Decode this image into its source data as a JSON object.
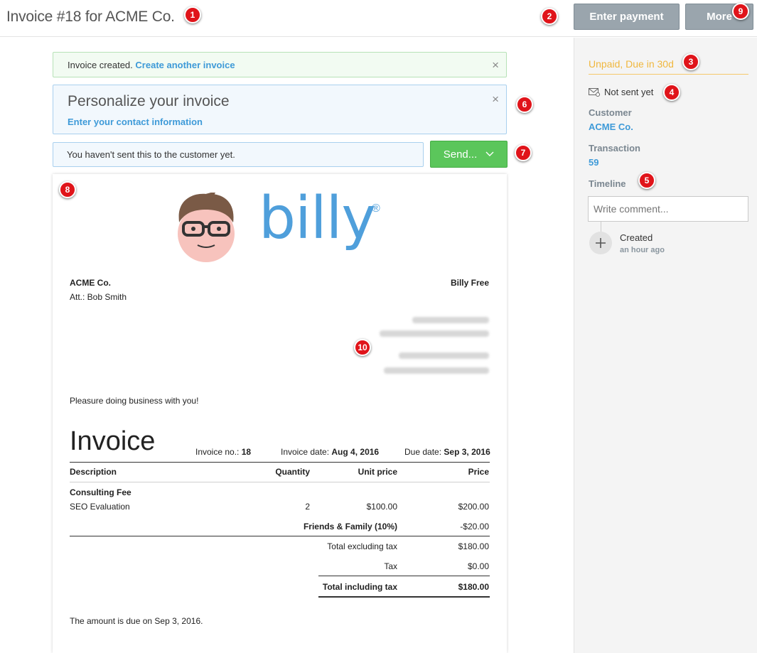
{
  "header": {
    "title": "Invoice #18 for ACME Co.",
    "enter_payment_label": "Enter payment",
    "more_label": "More"
  },
  "markers": [
    "1",
    "2",
    "3",
    "4",
    "5",
    "6",
    "7",
    "8",
    "9",
    "10"
  ],
  "alerts": {
    "created_text": "Invoice created.",
    "create_another_label": "Create another invoice",
    "close_glyph": "×",
    "personalize_title": "Personalize your invoice",
    "personalize_link": "Enter your contact information",
    "not_sent_notice": "You haven't sent this to the customer yet.",
    "send_label": "Send..."
  },
  "sidebar": {
    "status": "Unpaid, Due in 30d",
    "send_state": "Not sent yet",
    "customer_label": "Customer",
    "customer_value": "ACME Co.",
    "transaction_label": "Transaction",
    "transaction_value": "59",
    "timeline_label": "Timeline",
    "comment_placeholder": "Write comment...",
    "timeline_event": "Created",
    "timeline_time": "an hour ago"
  },
  "invoice": {
    "logo_text": "billy",
    "logo_mark": "®",
    "customer_name": "ACME Co.",
    "attention": "Att.: Bob Smith",
    "sender_name": "Billy Free",
    "greeting": "Pleasure doing business with you!",
    "heading": "Invoice",
    "invoice_no_label": "Invoice no.:",
    "invoice_no": "18",
    "invoice_date_label": "Invoice date:",
    "invoice_date": "Aug 4, 2016",
    "due_date_label": "Due date:",
    "due_date": "Sep 3, 2016",
    "columns": {
      "description": "Description",
      "quantity": "Quantity",
      "unit_price": "Unit price",
      "price": "Price"
    },
    "line_group": "Consulting Fee",
    "line_item": {
      "description": "SEO Evaluation",
      "quantity": "2",
      "unit_price": "$100.00",
      "price": "$200.00"
    },
    "discount_label": "Friends & Family (10%)",
    "discount_value": "-$20.00",
    "subtotal_label": "Total excluding tax",
    "subtotal_value": "$180.00",
    "tax_label": "Tax",
    "tax_value": "$0.00",
    "total_label": "Total including tax",
    "total_value": "$180.00",
    "due_note": "The amount is due on Sep 3, 2016."
  },
  "colors": {
    "accent_blue": "#3e9ad8",
    "status_orange": "#f0b73d",
    "send_green": "#5bc65b",
    "marker_red": "#e0141a"
  }
}
